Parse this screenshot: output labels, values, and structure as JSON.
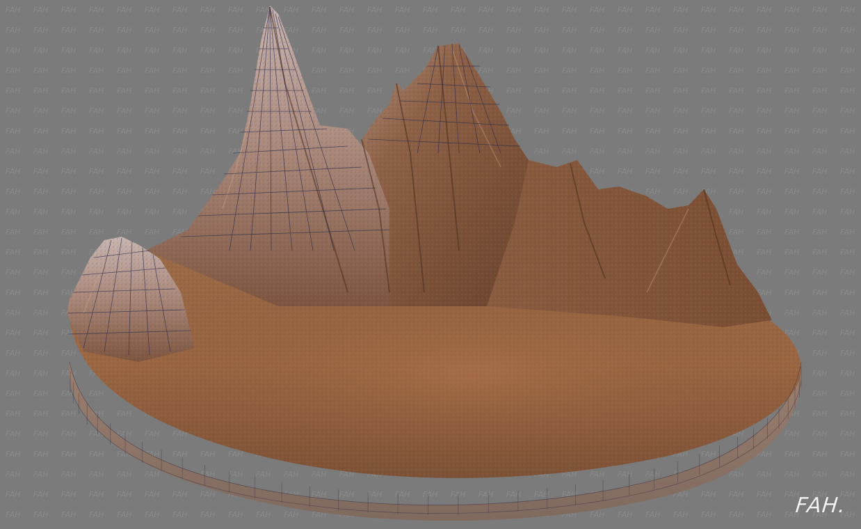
{
  "viewport": {
    "watermark_text": "FAH",
    "background_color": "#7b7b7b",
    "watermark_color": "#8a8a8a"
  },
  "model": {
    "subject": "terrain-mesh",
    "base_color": "#8a5a3a",
    "highlight_color": "#c08a62",
    "shadow_color": "#4a2e1e",
    "wire_color": "#2a2a4a"
  },
  "signature": {
    "text": "FAH."
  }
}
